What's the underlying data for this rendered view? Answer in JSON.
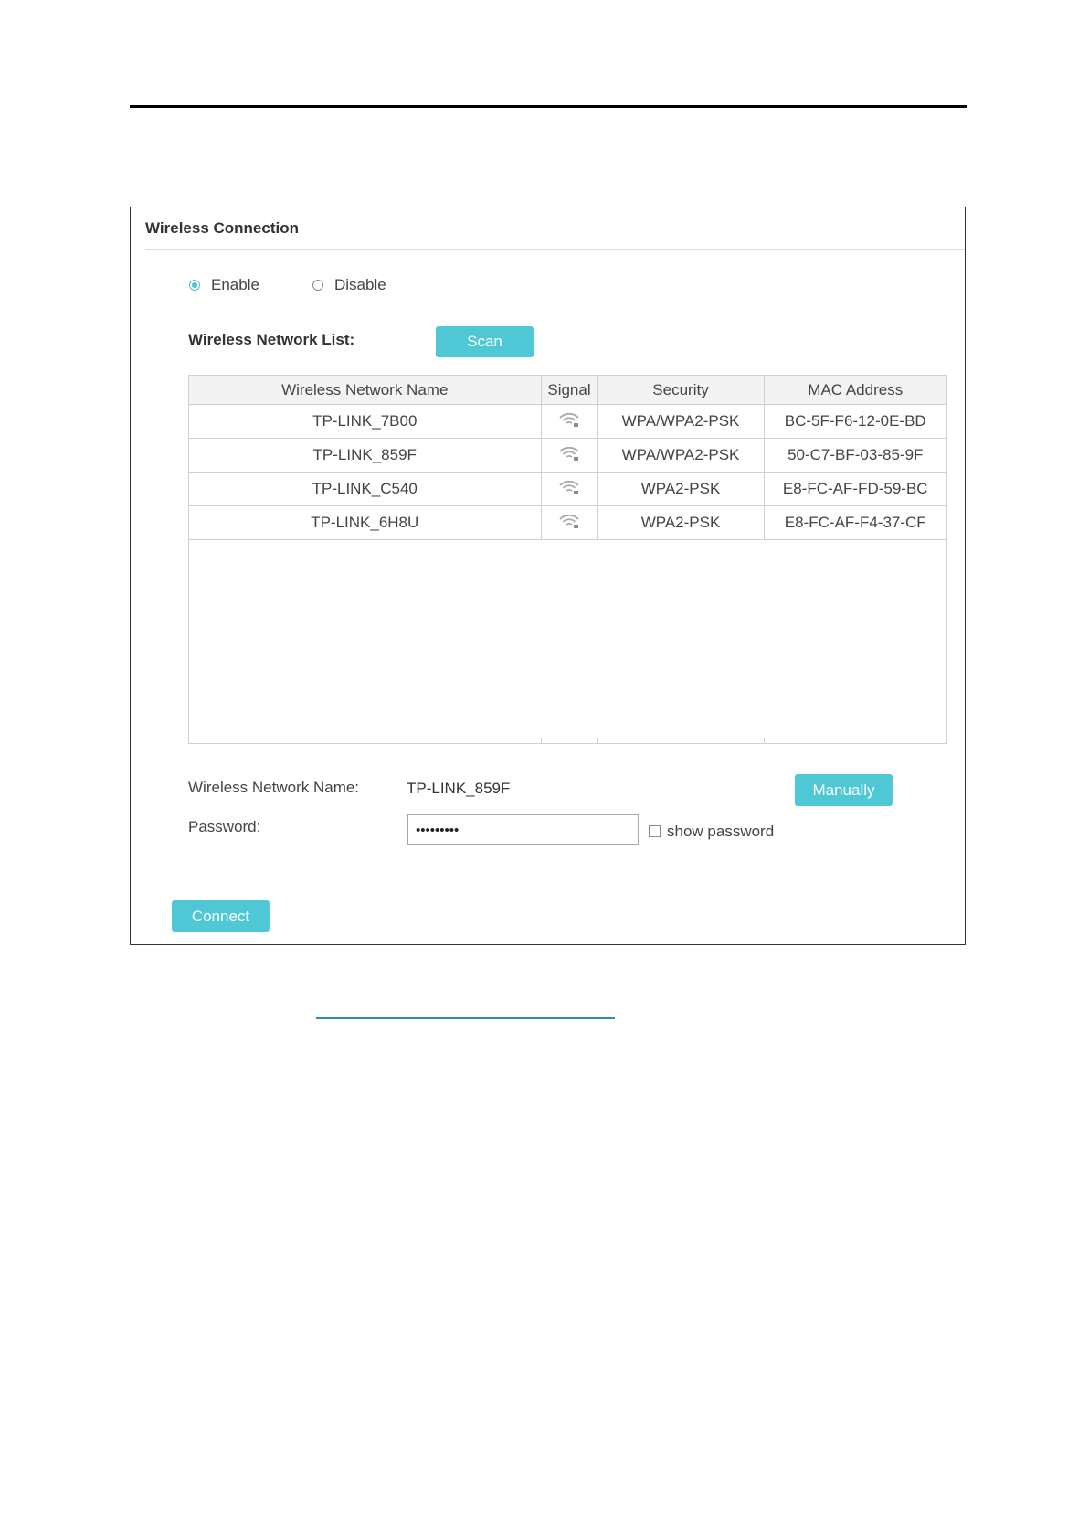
{
  "panel": {
    "title": "Wireless Connection"
  },
  "mode": {
    "enable_label": "Enable",
    "disable_label": "Disable",
    "selected": "enable"
  },
  "list": {
    "label": "Wireless Network List:",
    "scan_label": "Scan",
    "columns": [
      "Wireless Network Name",
      "Signal",
      "Security",
      "MAC Address"
    ],
    "rows": [
      {
        "name": "TP-LINK_7B00",
        "signal_icon": "wifi-signal-icon",
        "security": "WPA/WPA2-PSK",
        "mac": "BC-5F-F6-12-0E-BD"
      },
      {
        "name": "TP-LINK_859F",
        "signal_icon": "wifi-signal-icon",
        "security": "WPA/WPA2-PSK",
        "mac": "50-C7-BF-03-85-9F"
      },
      {
        "name": "TP-LINK_C540",
        "signal_icon": "wifi-signal-icon",
        "security": "WPA2-PSK",
        "mac": "E8-FC-AF-FD-59-BC"
      },
      {
        "name": "TP-LINK_6H8U",
        "signal_icon": "wifi-signal-icon",
        "security": "WPA2-PSK",
        "mac": "E8-FC-AF-F4-37-CF"
      }
    ]
  },
  "form": {
    "network_name_label": "Wireless Network Name:",
    "network_name_value": "TP-LINK_859F",
    "manually_label": "Manually",
    "password_label": "Password:",
    "password_value": "•••••••••",
    "show_password_label": "show password",
    "show_password_checked": false
  },
  "connect_label": "Connect",
  "colors": {
    "accent": "#4dc8d4",
    "link_underline": "#2a8fa8"
  }
}
